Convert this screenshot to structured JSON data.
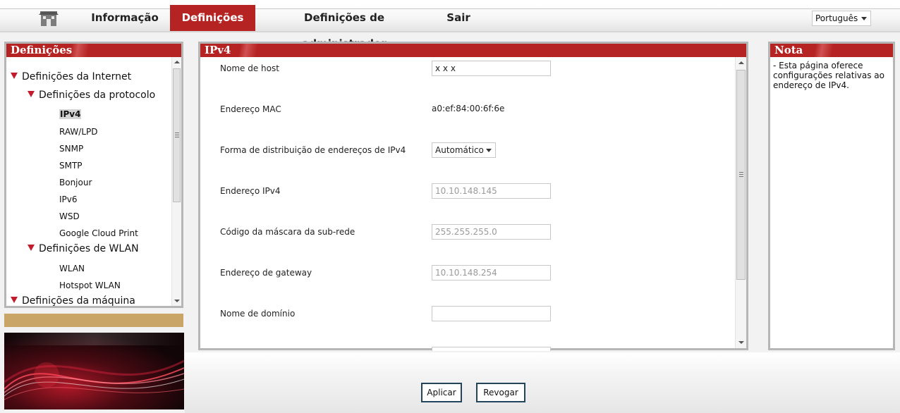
{
  "nav": {
    "tabs": [
      {
        "label": "Informação"
      },
      {
        "label": "Definições"
      },
      {
        "label": "Definições de administrador"
      },
      {
        "label": "Sair"
      }
    ],
    "active_tab": "Definições",
    "language": "Português",
    "home_icon": "home-icon"
  },
  "left_panel": {
    "title": "Definições",
    "tree": [
      {
        "label": "Definições da Internet"
      },
      {
        "label": "Definições da protocolo"
      },
      {
        "label": "IPv4"
      },
      {
        "label": "RAW/LPD"
      },
      {
        "label": "SNMP"
      },
      {
        "label": "SMTP"
      },
      {
        "label": "Bonjour"
      },
      {
        "label": "IPv6"
      },
      {
        "label": "WSD"
      },
      {
        "label": "Google Cloud Print"
      },
      {
        "label": "Definições de WLAN"
      },
      {
        "label": "WLAN"
      },
      {
        "label": "Hotspot WLAN"
      },
      {
        "label": "Definições da máquina"
      }
    ],
    "selected": "IPv4"
  },
  "main_panel": {
    "title": "IPv4",
    "fields": {
      "host_name": {
        "label": "Nome de host",
        "value": "x x x"
      },
      "mac": {
        "label": "Endereço MAC",
        "value": "a0:ef:84:00:6f:6e"
      },
      "distribution": {
        "label": "Forma de distribuição de endereços de IPv4",
        "value": "Automático"
      },
      "ipv4": {
        "label": "Endereço IPv4",
        "value": "10.10.148.145"
      },
      "subnet": {
        "label": "Código da máscara da sub-rede",
        "value": "255.255.255.0"
      },
      "gateway": {
        "label": "Endereço de gateway",
        "value": "10.10.148.254"
      },
      "domain": {
        "label": "Nome de domínio",
        "value": ""
      }
    }
  },
  "note_panel": {
    "title": "Nota",
    "text": "- Esta página oferece configurações relativas ao endereço de IPv4."
  },
  "buttons": {
    "apply": "Aplicar",
    "revoke": "Revogar"
  },
  "colors": {
    "accent": "#b52322",
    "tan": "#c9a668",
    "button_border": "#22455c"
  }
}
